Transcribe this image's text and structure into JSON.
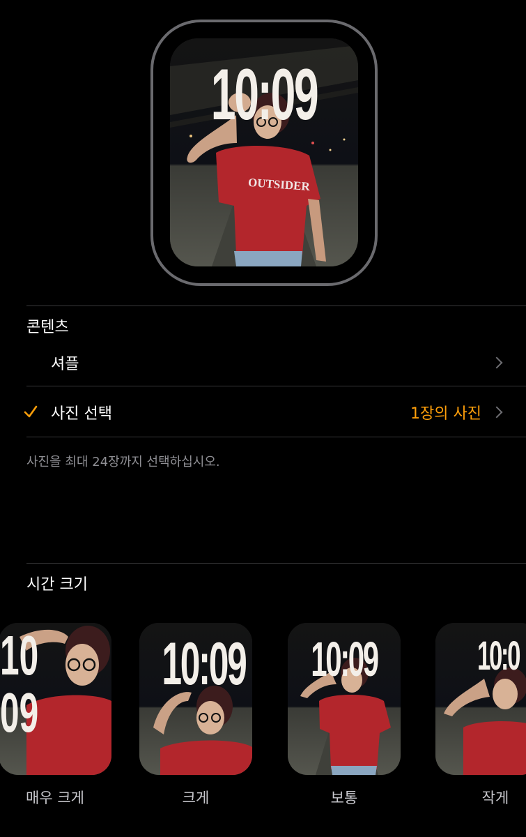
{
  "preview": {
    "time": "10:09",
    "shirt_text": "OUTSIDER"
  },
  "content_section": {
    "title": "콘텐츠",
    "shuffle_label": "셔플",
    "select_label": "사진 선택",
    "select_value": "1장의 사진",
    "hint": "사진을 최대 24장까지 선택하십시오."
  },
  "time_size_section": {
    "title": "시간 크기",
    "options": [
      {
        "label": "매우 크게",
        "line1": "10",
        "line2": "09"
      },
      {
        "label": "크게",
        "time": "10:09"
      },
      {
        "label": "보통",
        "time": "10:09"
      },
      {
        "label": "작게",
        "time": "10:0"
      }
    ]
  },
  "colors": {
    "accent": "#ff9f0a",
    "shirt": "#b3262c",
    "bezel": "#6a6a6e"
  },
  "icons": {
    "check": "checkmark-icon",
    "chevron": "chevron-right-icon"
  }
}
